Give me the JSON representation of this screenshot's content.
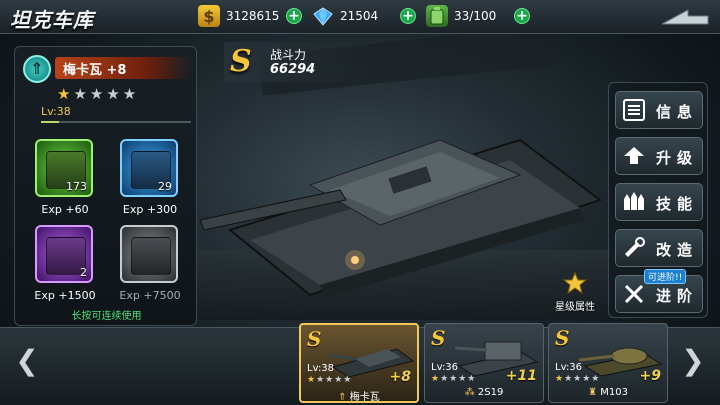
{
  "header": {
    "title": "坦克车库",
    "resources": [
      {
        "icon": "gold-coin-icon",
        "symbol": "$",
        "value": "3128615"
      },
      {
        "icon": "diamond-icon",
        "symbol": "",
        "value": "21504"
      },
      {
        "icon": "fuel-can-icon",
        "symbol": "",
        "value": "33/100"
      }
    ],
    "plus_label": "+"
  },
  "tank_panel": {
    "name": "梅卡瓦 +8",
    "stars": 1,
    "max_stars": 5,
    "level": "Lv:38",
    "boxes": [
      {
        "color": "green",
        "count": "173",
        "exp": "Exp +60"
      },
      {
        "color": "blue",
        "count": "29",
        "exp": "Exp +300"
      },
      {
        "color": "purple",
        "count": "2",
        "exp": "Exp +1500"
      },
      {
        "color": "gray",
        "count": "",
        "exp": "Exp +7500"
      }
    ],
    "hint": "长按可连续使用"
  },
  "power": {
    "rank": "S",
    "label": "战斗力",
    "value": "66294"
  },
  "menu": [
    {
      "label": "信息",
      "icon": "info-list-icon"
    },
    {
      "label": "升级",
      "icon": "upgrade-arrow-icon"
    },
    {
      "label": "技能",
      "icon": "skill-missiles-icon"
    },
    {
      "label": "改造",
      "icon": "modify-wrench-icon"
    },
    {
      "label": "进阶",
      "icon": "advance-tools-icon",
      "tag": "可进阶!!"
    }
  ],
  "star_attribute": {
    "label": "星级属性",
    "icon": "star-emblem-icon"
  },
  "tank_list": [
    {
      "rank": "S",
      "level": "Lv:38",
      "stars": 1,
      "plus": "+8",
      "name": "梅卡瓦",
      "badge_icon": "rank-chevron-icon",
      "selected": true
    },
    {
      "rank": "S",
      "level": "Lv:36",
      "stars": 1,
      "plus": "+11",
      "name": "2S19",
      "badge_icon": "artillery-icon",
      "selected": false
    },
    {
      "rank": "S",
      "level": "Lv:36",
      "stars": 1,
      "plus": "+9",
      "name": "M103",
      "badge_icon": "tank-shield-icon",
      "selected": false
    }
  ],
  "colors": {
    "accent_gold": "#f6c53a",
    "hint_green": "#4fe07a",
    "name_bar": "#b8431a"
  }
}
